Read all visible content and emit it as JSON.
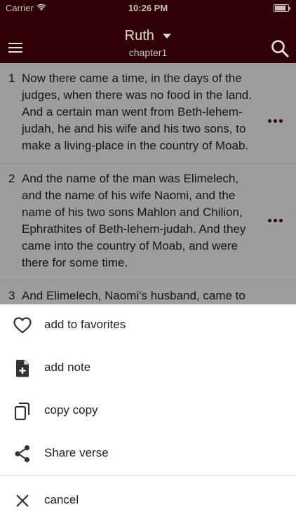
{
  "status": {
    "carrier": "Carrier",
    "time": "10:26 PM"
  },
  "header": {
    "book": "Ruth",
    "chapter": "chapter1",
    "background": "#2f0306"
  },
  "verses": [
    {
      "number": "1",
      "text": "Now there came a time, in the days of the judges, when there was no food in the land. And a certain man went from Beth-lehem-judah, he and his wife and his two sons, to make a living-place in the country of Moab."
    },
    {
      "number": "2",
      "text": "And the name of the man was Elimelech, and the name of his wife Naomi, and the name of his two sons Mahlon and Chilion, Ephrathites of Beth-lehem-judah. And they came into the country of Moab, and were there for some time."
    },
    {
      "number": "3",
      "text": "And Elimelech, Naomi's husband, came to his death; and she was left with her two sons."
    }
  ],
  "sheet": {
    "items": [
      {
        "label": "add to favorites",
        "icon": "heart-icon"
      },
      {
        "label": "add note",
        "icon": "note-add-icon"
      },
      {
        "label": "copy copy",
        "icon": "copy-icon"
      },
      {
        "label": "Share verse",
        "icon": "share-icon"
      },
      {
        "label": "cancel",
        "icon": "close-icon"
      }
    ]
  }
}
